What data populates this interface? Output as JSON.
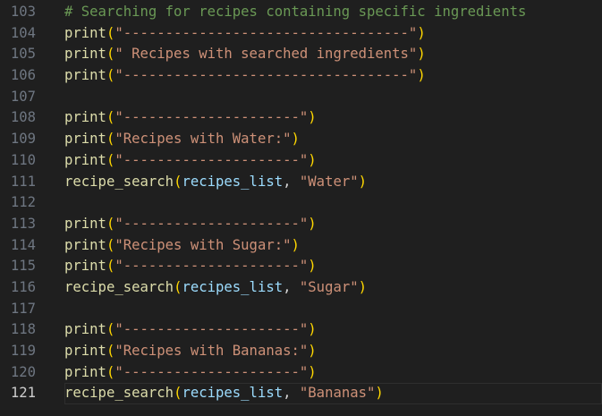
{
  "colors": {
    "background": "#1f1f1f",
    "line_number": "#6e7681",
    "line_number_active": "#cccccc",
    "comment": "#6a9955",
    "function": "#dcdcaa",
    "bracket": "#ffd700",
    "string": "#ce9178",
    "variable": "#9cdcfe",
    "punctuation": "#d4d4d4"
  },
  "editor": {
    "current_line": 121,
    "lines": [
      {
        "number": "103",
        "tokens": [
          {
            "t": "comment",
            "v": "# Searching for recipes containing specific ingredients"
          }
        ]
      },
      {
        "number": "104",
        "tokens": [
          {
            "t": "fn",
            "v": "print"
          },
          {
            "t": "paren",
            "v": "("
          },
          {
            "t": "str",
            "v": "\"----------------------------------\""
          },
          {
            "t": "paren",
            "v": ")"
          }
        ]
      },
      {
        "number": "105",
        "tokens": [
          {
            "t": "fn",
            "v": "print"
          },
          {
            "t": "paren",
            "v": "("
          },
          {
            "t": "str",
            "v": "\" Recipes with searched ingredients\""
          },
          {
            "t": "paren",
            "v": ")"
          }
        ]
      },
      {
        "number": "106",
        "tokens": [
          {
            "t": "fn",
            "v": "print"
          },
          {
            "t": "paren",
            "v": "("
          },
          {
            "t": "str",
            "v": "\"----------------------------------\""
          },
          {
            "t": "paren",
            "v": ")"
          }
        ]
      },
      {
        "number": "107",
        "tokens": []
      },
      {
        "number": "108",
        "tokens": [
          {
            "t": "fn",
            "v": "print"
          },
          {
            "t": "paren",
            "v": "("
          },
          {
            "t": "str",
            "v": "\"---------------------\""
          },
          {
            "t": "paren",
            "v": ")"
          }
        ]
      },
      {
        "number": "109",
        "tokens": [
          {
            "t": "fn",
            "v": "print"
          },
          {
            "t": "paren",
            "v": "("
          },
          {
            "t": "str",
            "v": "\"Recipes with Water:\""
          },
          {
            "t": "paren",
            "v": ")"
          }
        ]
      },
      {
        "number": "110",
        "tokens": [
          {
            "t": "fn",
            "v": "print"
          },
          {
            "t": "paren",
            "v": "("
          },
          {
            "t": "str",
            "v": "\"---------------------\""
          },
          {
            "t": "paren",
            "v": ")"
          }
        ]
      },
      {
        "number": "111",
        "tokens": [
          {
            "t": "fn",
            "v": "recipe_search"
          },
          {
            "t": "paren",
            "v": "("
          },
          {
            "t": "var",
            "v": "recipes_list"
          },
          {
            "t": "punct",
            "v": ", "
          },
          {
            "t": "str",
            "v": "\"Water\""
          },
          {
            "t": "paren",
            "v": ")"
          }
        ]
      },
      {
        "number": "112",
        "tokens": []
      },
      {
        "number": "113",
        "tokens": [
          {
            "t": "fn",
            "v": "print"
          },
          {
            "t": "paren",
            "v": "("
          },
          {
            "t": "str",
            "v": "\"---------------------\""
          },
          {
            "t": "paren",
            "v": ")"
          }
        ]
      },
      {
        "number": "114",
        "tokens": [
          {
            "t": "fn",
            "v": "print"
          },
          {
            "t": "paren",
            "v": "("
          },
          {
            "t": "str",
            "v": "\"Recipes with Sugar:\""
          },
          {
            "t": "paren",
            "v": ")"
          }
        ]
      },
      {
        "number": "115",
        "tokens": [
          {
            "t": "fn",
            "v": "print"
          },
          {
            "t": "paren",
            "v": "("
          },
          {
            "t": "str",
            "v": "\"---------------------\""
          },
          {
            "t": "paren",
            "v": ")"
          }
        ]
      },
      {
        "number": "116",
        "tokens": [
          {
            "t": "fn",
            "v": "recipe_search"
          },
          {
            "t": "paren",
            "v": "("
          },
          {
            "t": "var",
            "v": "recipes_list"
          },
          {
            "t": "punct",
            "v": ", "
          },
          {
            "t": "str",
            "v": "\"Sugar\""
          },
          {
            "t": "paren",
            "v": ")"
          }
        ]
      },
      {
        "number": "117",
        "tokens": []
      },
      {
        "number": "118",
        "tokens": [
          {
            "t": "fn",
            "v": "print"
          },
          {
            "t": "paren",
            "v": "("
          },
          {
            "t": "str",
            "v": "\"---------------------\""
          },
          {
            "t": "paren",
            "v": ")"
          }
        ]
      },
      {
        "number": "119",
        "tokens": [
          {
            "t": "fn",
            "v": "print"
          },
          {
            "t": "paren",
            "v": "("
          },
          {
            "t": "str",
            "v": "\"Recipes with Bananas:\""
          },
          {
            "t": "paren",
            "v": ")"
          }
        ]
      },
      {
        "number": "120",
        "tokens": [
          {
            "t": "fn",
            "v": "print"
          },
          {
            "t": "paren",
            "v": "("
          },
          {
            "t": "str",
            "v": "\"---------------------\""
          },
          {
            "t": "paren",
            "v": ")"
          }
        ]
      },
      {
        "number": "121",
        "tokens": [
          {
            "t": "fn",
            "v": "recipe_search"
          },
          {
            "t": "paren",
            "v": "("
          },
          {
            "t": "var",
            "v": "recipes_list"
          },
          {
            "t": "punct",
            "v": ", "
          },
          {
            "t": "str",
            "v": "\"Bananas\""
          },
          {
            "t": "paren",
            "v": ")"
          }
        ]
      }
    ]
  }
}
